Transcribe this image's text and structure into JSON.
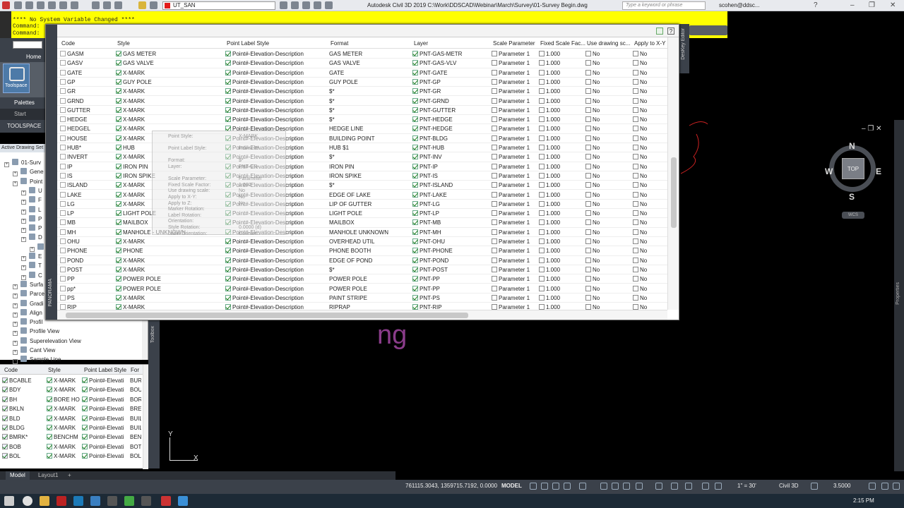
{
  "titlebar": {
    "layer_name": "UT_SAN",
    "app_title": "Autodesk Civil 3D 2019   C:\\Work\\DDSCAD\\Webinar\\March\\Survey\\01-Survey Begin.dwg",
    "search_placeholder": "Type a keyword or phrase",
    "user": "scohen@ddsc..."
  },
  "command": {
    "line1": "**** No System Variable Changed ****",
    "line2": "Command:",
    "line3": "Command:"
  },
  "ribbon": {
    "home_tab": "Home",
    "toolspace_label": "Toolspace",
    "palettes_label": "Palettes",
    "start_tab": "Start"
  },
  "toolspace": {
    "title": "TOOLSPACE",
    "active_drawing": "Active Drawing Set",
    "tree": [
      {
        "label": "01-Surv"
      },
      {
        "label": "Gene"
      },
      {
        "label": "Point"
      },
      {
        "label": "U"
      },
      {
        "label": "F"
      },
      {
        "label": "L"
      },
      {
        "label": "P"
      },
      {
        "label": "P"
      },
      {
        "label": "D"
      },
      {
        "label": ""
      },
      {
        "label": "E"
      },
      {
        "label": "T"
      },
      {
        "label": "C"
      },
      {
        "label": "Surfa"
      },
      {
        "label": "Parce"
      },
      {
        "label": "Gradi"
      },
      {
        "label": "Align"
      },
      {
        "label": "Profil"
      },
      {
        "label": "Profile View"
      },
      {
        "label": "Superelevation View"
      },
      {
        "label": "Cant View"
      },
      {
        "label": "Sample Line"
      }
    ]
  },
  "toolbox_label": "Toolbox",
  "mini_table": {
    "headers": [
      "Code",
      "Style",
      "Point Label Style",
      "For"
    ],
    "rows": [
      [
        "BCABLE",
        "X-MARK",
        "Point#-Elevati",
        "BUR"
      ],
      [
        "BDY",
        "X-MARK",
        "Point#-Elevati",
        "BOU"
      ],
      [
        "BH",
        "BORE HO",
        "Point#-Elevati",
        "BOR"
      ],
      [
        "BKLN",
        "X-MARK",
        "Point#-Elevati",
        "BRE"
      ],
      [
        "BLD",
        "X-MARK",
        "Point#-Elevati",
        "BUIL"
      ],
      [
        "BLDG",
        "X-MARK",
        "Point#-Elevati",
        "BUIL"
      ],
      [
        "BMRK*",
        "BENCHM",
        "Point#-Elevati",
        "BEN"
      ],
      [
        "BOB",
        "X-MARK",
        "Point#-Elevati",
        "BOT"
      ],
      [
        "BOL",
        "X-MARK",
        "Point#-Elevati",
        "BOL"
      ]
    ]
  },
  "panorama": {
    "label": "PANORAMA",
    "headers": [
      "Code",
      "Style",
      "Point Label Style",
      "Format",
      "Layer",
      "Scale Parameter",
      "Fixed Scale Fac...",
      "Use drawing sc...",
      "Apply to X-Y"
    ],
    "rows": [
      [
        "GASM",
        "GAS METER",
        "Point#-Elevation-Description",
        "GAS METER",
        "PNT-GAS-METR",
        "Parameter 1",
        "1.000",
        "No",
        "No"
      ],
      [
        "GASV",
        "GAS VALVE",
        "Point#-Elevation-Description",
        "GAS VALVE",
        "PNT-GAS-VLV",
        "Parameter 1",
        "1.000",
        "No",
        "No"
      ],
      [
        "GATE",
        "X-MARK",
        "Point#-Elevation-Description",
        "GATE",
        "PNT-GATE",
        "Parameter 1",
        "1.000",
        "No",
        "No"
      ],
      [
        "GP",
        "GUY POLE",
        "Point#-Elevation-Description",
        "GUY POLE",
        "PNT-GP",
        "Parameter 1",
        "1.000",
        "No",
        "No"
      ],
      [
        "GR",
        "X-MARK",
        "Point#-Elevation-Description",
        "$*",
        "PNT-GR",
        "Parameter 1",
        "1.000",
        "No",
        "No"
      ],
      [
        "GRND",
        "X-MARK",
        "Point#-Elevation-Description",
        "$*",
        "PNT-GRND",
        "Parameter 1",
        "1.000",
        "No",
        "No"
      ],
      [
        "GUTTER",
        "X-MARK",
        "Point#-Elevation-Description",
        "$*",
        "PNT-GUTTER",
        "Parameter 1",
        "1.000",
        "No",
        "No"
      ],
      [
        "HEDGE",
        "X-MARK",
        "Point#-Elevation-Description",
        "$*",
        "PNT-HEDGE",
        "Parameter 1",
        "1.000",
        "No",
        "No"
      ],
      [
        "HEDGEL",
        "X-MARK",
        "Point#-Elevation-Description",
        "HEDGE LINE",
        "PNT-HEDGE",
        "Parameter 1",
        "1.000",
        "No",
        "No"
      ],
      [
        "HOUSE",
        "X-MARK",
        "Point#-Elevation-Description",
        "BUILDING POINT",
        "PNT-BLDG",
        "Parameter 1",
        "1.000",
        "No",
        "No"
      ],
      [
        "HUB*",
        "HUB",
        "Point#-Elevation-Description",
        "HUB $1",
        "PNT-HUB",
        "Parameter 1",
        "1.000",
        "No",
        "No"
      ],
      [
        "INVERT",
        "X-MARK",
        "Point#-Elevation-Description",
        "$*",
        "PNT-INV",
        "Parameter 1",
        "1.000",
        "No",
        "No"
      ],
      [
        "IP",
        "IRON PIN",
        "Point#-Elevation-Description",
        "IRON PIN",
        "PNT-IP",
        "Parameter 1",
        "1.000",
        "No",
        "No"
      ],
      [
        "IS",
        "IRON SPIKE",
        "Point#-Elevation-Description",
        "IRON SPIKE",
        "PNT-IS",
        "Parameter 1",
        "1.000",
        "No",
        "No"
      ],
      [
        "ISLAND",
        "X-MARK",
        "Point#-Elevation-Description",
        "$*",
        "PNT-ISLAND",
        "Parameter 1",
        "1.000",
        "No",
        "No"
      ],
      [
        "LAKE",
        "X-MARK",
        "Point#-Elevation-Description",
        "EDGE OF LAKE",
        "PNT-LAKE",
        "Parameter 1",
        "1.000",
        "No",
        "No"
      ],
      [
        "LG",
        "X-MARK",
        "Point#-Elevation-Description",
        "LIP OF GUTTER",
        "PNT-LG",
        "Parameter 1",
        "1.000",
        "No",
        "No"
      ],
      [
        "LP",
        "LIGHT POLE",
        "Point#-Elevation-Description",
        "LIGHT POLE",
        "PNT-LP",
        "Parameter 1",
        "1.000",
        "No",
        "No"
      ],
      [
        "MB",
        "MAILBOX",
        "Point#-Elevation-Description",
        "MAILBOX",
        "PNT-MB",
        "Parameter 1",
        "1.000",
        "No",
        "No"
      ],
      [
        "MH",
        "MANHOLE - UNKNOWN",
        "Point#-Elevation-Description",
        "MANHOLE UNKNOWN",
        "PNT-MH",
        "Parameter 1",
        "1.000",
        "No",
        "No"
      ],
      [
        "OHU",
        "X-MARK",
        "Point#-Elevation-Description",
        "OVERHEAD UTIL",
        "PNT-OHU",
        "Parameter 1",
        "1.000",
        "No",
        "No"
      ],
      [
        "PHONE",
        "PHONE",
        "Point#-Elevation-Description",
        "PHONE BOOTH",
        "PNT-PHONE",
        "Parameter 1",
        "1.000",
        "No",
        "No"
      ],
      [
        "POND",
        "X-MARK",
        "Point#-Elevation-Description",
        "EDGE OF POND",
        "PNT-POND",
        "Parameter 1",
        "1.000",
        "No",
        "No"
      ],
      [
        "POST",
        "X-MARK",
        "Point#-Elevation-Description",
        "$*",
        "PNT-POST",
        "Parameter 1",
        "1.000",
        "No",
        "No"
      ],
      [
        "PP",
        "POWER POLE",
        "Point#-Elevation-Description",
        "POWER POLE",
        "PNT-PP",
        "Parameter 1",
        "1.000",
        "No",
        "No"
      ],
      [
        "pp*",
        "POWER POLE",
        "Point#-Elevation-Description",
        "POWER POLE",
        "PNT-PP",
        "Parameter 1",
        "1.000",
        "No",
        "No"
      ],
      [
        "PS",
        "X-MARK",
        "Point#-Elevation-Description",
        "PAINT STRIPE",
        "PNT-PS",
        "Parameter 1",
        "1.000",
        "No",
        "No"
      ],
      [
        "RIP",
        "X-MARK",
        "Point#-Elevation-Description",
        "RIPRAP",
        "PNT-RIP",
        "Parameter 1",
        "1.000",
        "No",
        "No"
      ]
    ]
  },
  "ghost": [
    [
      "Point Style:",
      "X-MARK"
    ],
    [
      "",
      ""
    ],
    [
      "Point Label Style:",
      "Point#-El..."
    ],
    [
      "",
      ""
    ],
    [
      "Format:",
      "$*"
    ],
    [
      "Layer:",
      "PNT-GR"
    ],
    [
      "",
      ""
    ],
    [
      "Scale Parameter:",
      "Parameter"
    ],
    [
      "Fixed Scale Factor:",
      "1.000"
    ],
    [
      "Use drawing scale:",
      "No"
    ],
    [
      "Apply to X-Y:",
      "No"
    ],
    [
      "Apply to Z:",
      "No"
    ],
    [
      "Marker Rotation:",
      ""
    ],
    [
      "Label Rotation:",
      ""
    ],
    [
      "Orientation:",
      ""
    ],
    [
      "Style Rotation:",
      "0.0000 (d)"
    ],
    [
      "Label Orientation:",
      "Counter..."
    ]
  ],
  "drawing": {
    "visible_text": "ng",
    "text_color": "#8a3c8a"
  },
  "viewcube": {
    "top": "TOP",
    "n": "N",
    "s": "S",
    "e": "E",
    "w": "W",
    "wcs": "WCS"
  },
  "side_labels": {
    "deskey": "DesKey Editor",
    "properties": "Properties"
  },
  "ucs": {
    "x": "X",
    "y": "Y"
  },
  "layout_tabs": [
    "Model",
    "Layout1",
    "+"
  ],
  "status": {
    "coords": "761115.3043, 1359715.7192, 0.0000",
    "model": "MODEL",
    "scale": "1\" = 30'",
    "workspace": "Civil 3D",
    "lineweight": "3.5000"
  },
  "clock": "2:15 PM",
  "colors": {
    "cmd_bg": "#ffff00",
    "canvas": "#000000",
    "arc": "#cc2222"
  }
}
